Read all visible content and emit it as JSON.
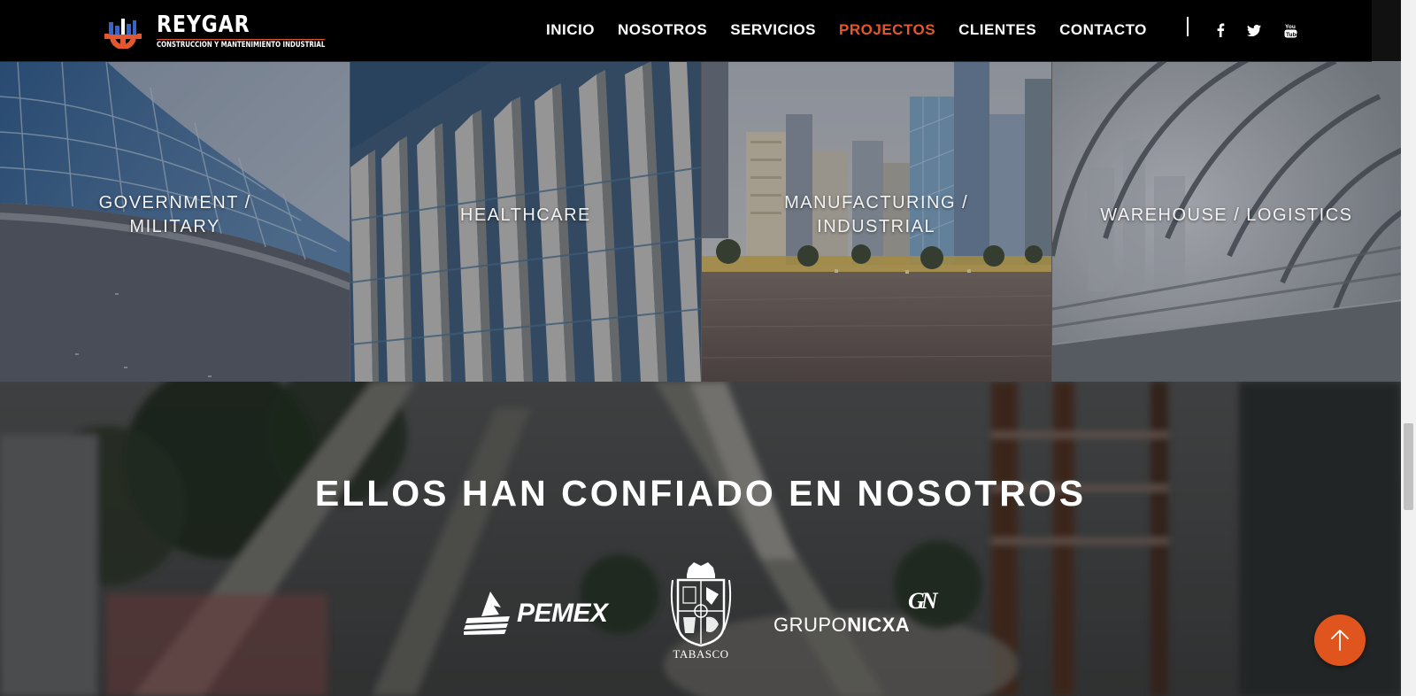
{
  "brand": {
    "name": "REYGAR",
    "tagline": "CONSTRUCCION Y MANTENIMIENTO INDUSTRIAL",
    "accent_color": "#e4572e"
  },
  "nav": {
    "items": [
      {
        "label": "INICIO",
        "active": false
      },
      {
        "label": "NOSOTROS",
        "active": false
      },
      {
        "label": "SERVICIOS",
        "active": false
      },
      {
        "label": "PROJECTOS",
        "active": true
      },
      {
        "label": "CLIENTES",
        "active": false
      },
      {
        "label": "CONTACTO",
        "active": false
      }
    ],
    "social": [
      "facebook-icon",
      "twitter-icon",
      "youtube-icon"
    ]
  },
  "projects": {
    "tiles": [
      {
        "label": "GOVERNMENT / MILITARY"
      },
      {
        "label": "HEALTHCARE"
      },
      {
        "label": "MANUFACTURING / INDUSTRIAL"
      },
      {
        "label": "WAREHOUSE / LOGISTICS"
      }
    ]
  },
  "clients": {
    "title": "ELLOS HAN CONFIADO EN NOSOTROS",
    "logos": [
      {
        "name": "pemex",
        "text": "PEMEX"
      },
      {
        "name": "tabasco",
        "text": "TABASCO"
      },
      {
        "name": "grupo-nicxa",
        "text_a": "GRUPO",
        "text_b": "NICXA",
        "monogram": "GN"
      }
    ]
  },
  "back_to_top": {
    "icon": "arrow-up-icon",
    "color": "#e0541d"
  }
}
